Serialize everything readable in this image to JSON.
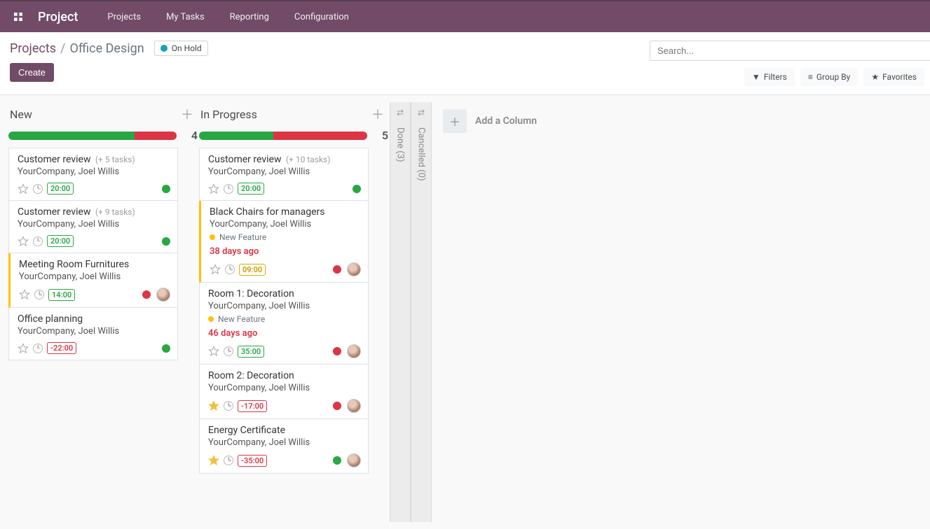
{
  "nav": {
    "brand": "Project",
    "items": [
      "Projects",
      "My Tasks",
      "Reporting",
      "Configuration"
    ]
  },
  "breadcrumb": {
    "root": "Projects",
    "current": "Office Design",
    "status": "On Hold"
  },
  "actions": {
    "create": "Create"
  },
  "search": {
    "placeholder": "Search..."
  },
  "toolbar": {
    "filters": "Filters",
    "groupby": "Group By",
    "favorites": "Favorites"
  },
  "add_column_label": "Add a Column",
  "columns": [
    {
      "title": "New",
      "count": "4",
      "progress": {
        "green": 75,
        "red": 25
      },
      "cards": [
        {
          "title": "Customer review",
          "subtasks": "(+ 5 tasks)",
          "company": "YourCompany, Joel Willis",
          "hours": "20:00",
          "hours_style": "green",
          "state": "green",
          "star": false,
          "avatar": false
        },
        {
          "title": "Customer review",
          "subtasks": "(+ 9 tasks)",
          "company": "YourCompany, Joel Willis",
          "hours": "20:00",
          "hours_style": "green",
          "state": "green",
          "star": false,
          "avatar": false
        },
        {
          "title": "Meeting Room Furnitures",
          "company": "YourCompany, Joel Willis",
          "hours": "14:00",
          "hours_style": "green",
          "state": "red",
          "star": false,
          "avatar": true,
          "accent": "yellow"
        },
        {
          "title": "Office planning",
          "company": "YourCompany, Joel Willis",
          "hours": "-22:00",
          "hours_style": "red",
          "state": "green",
          "star": false,
          "avatar": false
        }
      ]
    },
    {
      "title": "In Progress",
      "count": "5",
      "progress": {
        "green": 44,
        "red": 56
      },
      "cards": [
        {
          "title": "Customer review",
          "subtasks": "(+ 10 tasks)",
          "company": "YourCompany, Joel Willis",
          "hours": "20:00",
          "hours_style": "green",
          "state": "green",
          "star": false,
          "avatar": false
        },
        {
          "title": "Black Chairs for managers",
          "company": "YourCompany, Joel Willis",
          "tag": "New Feature",
          "deadline": "38 days ago",
          "hours": "09:00",
          "hours_style": "yellow",
          "state": "red",
          "star": false,
          "avatar": true,
          "accent": "yellow"
        },
        {
          "title": "Room 1: Decoration",
          "company": "YourCompany, Joel Willis",
          "tag": "New Feature",
          "deadline": "46 days ago",
          "hours": "35:00",
          "hours_style": "green",
          "state": "red",
          "star": false,
          "avatar": true
        },
        {
          "title": "Room 2: Decoration",
          "company": "YourCompany, Joel Willis",
          "hours": "-17:00",
          "hours_style": "red",
          "state": "red",
          "star": true,
          "avatar": true
        },
        {
          "title": "Energy Certificate",
          "company": "YourCompany, Joel Willis",
          "hours": "-35:00",
          "hours_style": "red",
          "state": "green",
          "star": true,
          "avatar": true
        }
      ]
    }
  ],
  "folded": [
    {
      "label": "Done (3)"
    },
    {
      "label": "Cancelled (0)"
    }
  ]
}
